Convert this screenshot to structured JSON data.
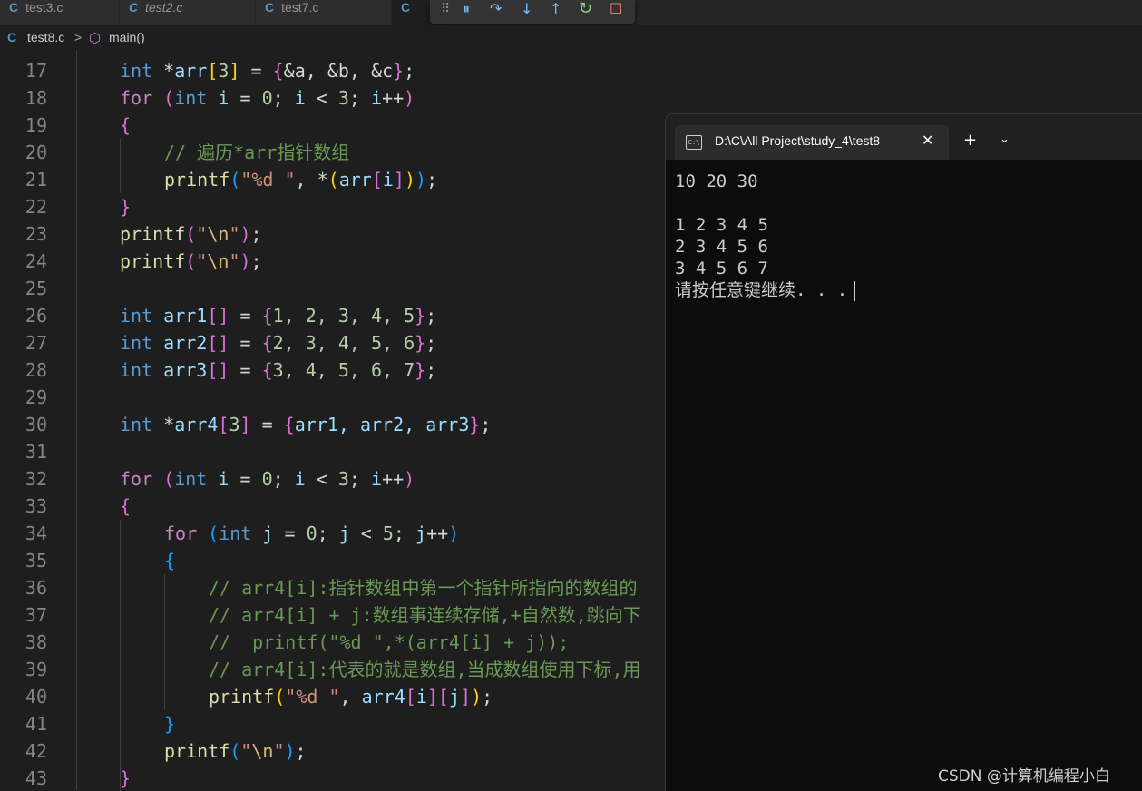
{
  "tabs": [
    {
      "label": "test3.c",
      "icon": "C"
    },
    {
      "label": "test2.c",
      "icon": "C"
    },
    {
      "label": "test7.c",
      "icon": "C"
    },
    {
      "label": "",
      "icon": "C"
    }
  ],
  "breadcrumb": {
    "file": "test8.c",
    "file_icon": "C",
    "sep": ">",
    "symbol": "main()"
  },
  "debug_toolbar": {
    "drag": "⠿",
    "pause": "⏸",
    "step_over": "↷",
    "step_into": "↓",
    "step_out": "↑",
    "restart": "↻",
    "stop": "☐"
  },
  "editor": {
    "line_numbers": [
      "17",
      "18",
      "19",
      "20",
      "21",
      "22",
      "23",
      "24",
      "25",
      "26",
      "27",
      "28",
      "29",
      "30",
      "31",
      "32",
      "33",
      "34",
      "35",
      "36",
      "37",
      "38",
      "39",
      "40",
      "41",
      "42",
      "43"
    ]
  },
  "code": {
    "l17": {
      "kw": "int",
      "a": " *",
      "v1": "arr",
      "b1": "[",
      "n1": "3",
      "b2": "]",
      "eq": " = ",
      "br1": "{",
      "rest": "&a, &b, &c",
      "br2": "}",
      "end": ";"
    },
    "l18": {
      "kw": "for",
      "sp": " ",
      "p1": "(",
      "kw2": "int",
      "v1": " i",
      "op1": " = ",
      "n1": "0",
      "s1": "; ",
      "v2": "i",
      "op2": " < ",
      "n2": "3",
      "s2": "; ",
      "v3": "i",
      "op3": "++",
      "p2": ")"
    },
    "l19": {
      "b": "{"
    },
    "l20": {
      "c": "// 遍历*arr指针数组"
    },
    "l21": {
      "fn": "printf",
      "p1": "(",
      "s": "\"%d \"",
      "c": ", ",
      "op": "*",
      "p2": "(",
      "v": "arr",
      "b1": "[",
      "v2": "i",
      "b2": "]",
      "p3": ")",
      "p4": ")",
      "end": ";"
    },
    "l22": {
      "b": "}"
    },
    "l23": {
      "fn": "printf",
      "p1": "(",
      "q1": "\"",
      "e": "\\n",
      "q2": "\"",
      "p2": ")",
      "end": ";"
    },
    "l24": {
      "fn": "printf",
      "p1": "(",
      "q1": "\"",
      "e": "\\n",
      "q2": "\"",
      "p2": ")",
      "end": ";"
    },
    "l26": {
      "kw": "int",
      "v": " arr1",
      "b1": "[",
      "b2": "]",
      "eq": " = ",
      "br1": "{",
      "n": "1, 2, 3, 4, 5",
      "br2": "}",
      "end": ";"
    },
    "l27": {
      "kw": "int",
      "v": " arr2",
      "b1": "[",
      "b2": "]",
      "eq": " = ",
      "br1": "{",
      "n": "2, 3, 4, 5, 6",
      "br2": "}",
      "end": ";"
    },
    "l28": {
      "kw": "int",
      "v": " arr3",
      "b1": "[",
      "b2": "]",
      "eq": " = ",
      "br1": "{",
      "n": "3, 4, 5, 6, 7",
      "br2": "}",
      "end": ";"
    },
    "l30": {
      "kw": "int",
      "a": " *",
      "v": "arr4",
      "b1": "[",
      "n": "3",
      "b2": "]",
      "eq": " = ",
      "br1": "{",
      "vals": "arr1, arr2, arr3",
      "br2": "}",
      "end": ";"
    },
    "l32": {
      "kw": "for",
      "sp": " ",
      "p1": "(",
      "kw2": "int",
      "v1": " i",
      "op1": " = ",
      "n1": "0",
      "s1": "; ",
      "v2": "i",
      "op2": " < ",
      "n2": "3",
      "s2": "; ",
      "v3": "i",
      "op3": "++",
      "p2": ")"
    },
    "l33": {
      "b": "{"
    },
    "l34": {
      "kw": "for",
      "sp": " ",
      "p1": "(",
      "kw2": "int",
      "v1": " j",
      "op1": " = ",
      "n1": "0",
      "s1": "; ",
      "v2": "j",
      "op2": " < ",
      "n2": "5",
      "s2": "; ",
      "v3": "j",
      "op3": "++",
      "p2": ")"
    },
    "l35": {
      "b": "{"
    },
    "l36": {
      "c": "// arr4[i]:指针数组中第一个指针所指向的数组的"
    },
    "l37": {
      "c": "// arr4[i] + j:数组事连续存储,+自然数,跳向下"
    },
    "l38": {
      "c": "//  printf(\"%d \",*(arr4[i] + j));"
    },
    "l39": {
      "c": "// arr4[i]:代表的就是数组,当成数组使用下标,用"
    },
    "l40": {
      "fn": "printf",
      "p1": "(",
      "s": "\"%d \"",
      "c": ", ",
      "v": "arr4",
      "b1": "[",
      "v2": "i",
      "b2": "]",
      "b3": "[",
      "v3": "j",
      "b4": "]",
      "p2": ")",
      "end": ";"
    },
    "l41": {
      "b": "}"
    },
    "l42": {
      "fn": "printf",
      "p1": "(",
      "q1": "\"",
      "e": "\\n",
      "q2": "\"",
      "p2": ")",
      "end": ";"
    },
    "l43": {
      "b": "}"
    }
  },
  "terminal": {
    "icon": "C:\\",
    "title": "D:\\C\\All Project\\study_4\\test8",
    "close": "✕",
    "new_tab": "+",
    "dropdown": "⌄",
    "lines": [
      "10 20 30",
      "",
      "1 2 3 4 5",
      "2 3 4 5 6",
      "3 4 5 6 7",
      "请按任意键继续. . ."
    ]
  },
  "watermark": "CSDN @计算机编程小白"
}
